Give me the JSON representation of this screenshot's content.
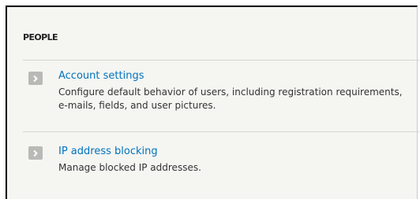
{
  "section": {
    "title": "PEOPLE"
  },
  "items": [
    {
      "title": "Account settings",
      "description": "Configure default behavior of users, including registration requirements, e-mails, fields, and user pictures.",
      "icon": "chevron-right-icon"
    },
    {
      "title": "IP address blocking",
      "description": "Manage blocked IP addresses.",
      "icon": "chevron-right-icon"
    }
  ],
  "colors": {
    "link": "#0074bd",
    "panel_background": "#f5f5f2",
    "icon_background": "#b9b9b6"
  }
}
